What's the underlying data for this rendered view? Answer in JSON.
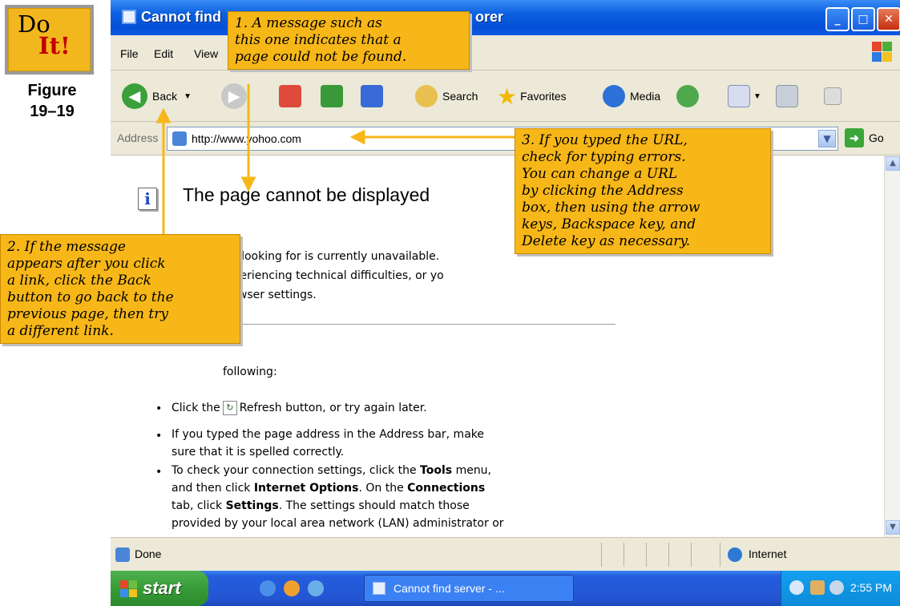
{
  "figure": {
    "badge_do": "Do",
    "badge_it": "It!",
    "label_line1": "Figure",
    "label_line2": "19–19"
  },
  "window": {
    "title": "Cannot find server - Microsoft Internet Explorer",
    "title_visible": "Cannot find",
    "title_suffix_visible": "orer"
  },
  "menu": {
    "items": [
      "File",
      "Edit",
      "View"
    ]
  },
  "toolbar": {
    "back_label": "Back",
    "search_label": "Search",
    "favorites_label": "Favorites",
    "media_label": "Media"
  },
  "address": {
    "label": "Address",
    "url": "http://www.yohoo.com",
    "go_label": "Go"
  },
  "page": {
    "heading": "The page cannot be displayed",
    "para1_line1": "are looking for is currently unavailable.",
    "para1_line2": "experiencing technical difficulties, or yo",
    "para1_line3": "browser settings.",
    "try_line": "following:",
    "bullet1_pre": "Click the",
    "bullet1_post": "Refresh button, or try again later.",
    "bullet2_line1": "If you typed the page address in the Address bar, make",
    "bullet2_line2": "sure that it is spelled correctly.",
    "bullet3_line1_pre": "To check your connection settings, click the",
    "bullet3_tools": "Tools",
    "bullet3_line1_post": "menu,",
    "bullet3_line2_pre": "and then click",
    "bullet3_options": "Internet Options",
    "bullet3_line2_mid": ". On the",
    "bullet3_connections": "Connections",
    "bullet3_line3_pre": "tab, click",
    "bullet3_settings": "Settings",
    "bullet3_line3_post": ". The settings should match those",
    "bullet3_line4": "provided by your local area network (LAN) administrator or"
  },
  "status": {
    "left": "Done",
    "zone": "Internet"
  },
  "taskbar": {
    "start_label": "start",
    "task_label": "Cannot find server - ...",
    "clock": "2:55 PM"
  },
  "callouts": {
    "c1": [
      "1. A message such as",
      "this one indicates that a",
      "page could not be found."
    ],
    "c2": [
      "2. If the message",
      "appears after you click",
      "a link, click the Back",
      "button to go back to the",
      "previous page, then try",
      "a different link."
    ],
    "c3": [
      "3. If you typed the URL,",
      "check for typing errors.",
      "You can change a URL",
      "by clicking the Address",
      "box, then using the arrow",
      "keys, Backspace key, and",
      "Delete key as necessary."
    ]
  },
  "colors": {
    "callout_bg": "#f7b718",
    "titlebar_blue": "#0550d5",
    "taskbar_blue": "#2354d0",
    "start_green": "#379c37"
  }
}
